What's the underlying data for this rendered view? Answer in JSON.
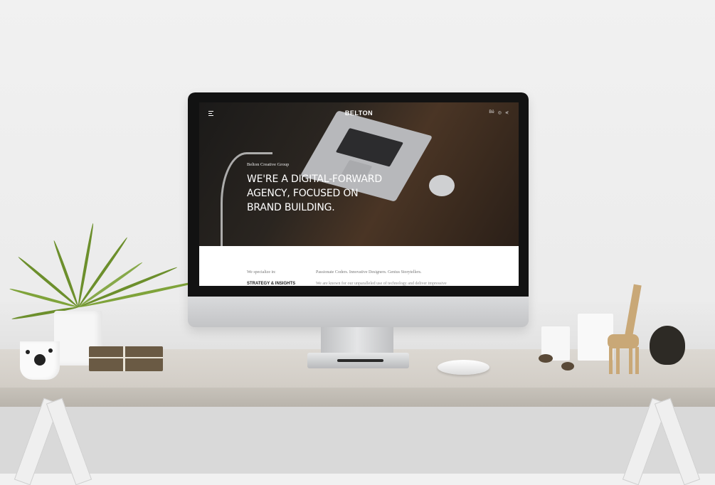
{
  "scene": {
    "description_type": "desktop-mockup"
  },
  "site": {
    "menu_icon": "hamburger-icon",
    "logo": "BELTON",
    "social_icons": [
      "Bē",
      "◎",
      "⋞"
    ],
    "eyebrow": "Belton Creative Group",
    "headline": "WE'RE A DIGITAL-FORWARD AGENCY, FOCUSED ON BRAND BUILDING.",
    "specialize_label": "We specialize in:",
    "specialize_item": "STRATEGY & INSIGHTS",
    "tagline": "Passionate Coders. Innovative Designers. Genius Storytellers.",
    "description": "We are known for our unparalleled use of technology and deliver impressive"
  },
  "colors": {
    "hero_dark": "#1b1a19",
    "wood": "#4a3525",
    "white": "#ffffff"
  }
}
